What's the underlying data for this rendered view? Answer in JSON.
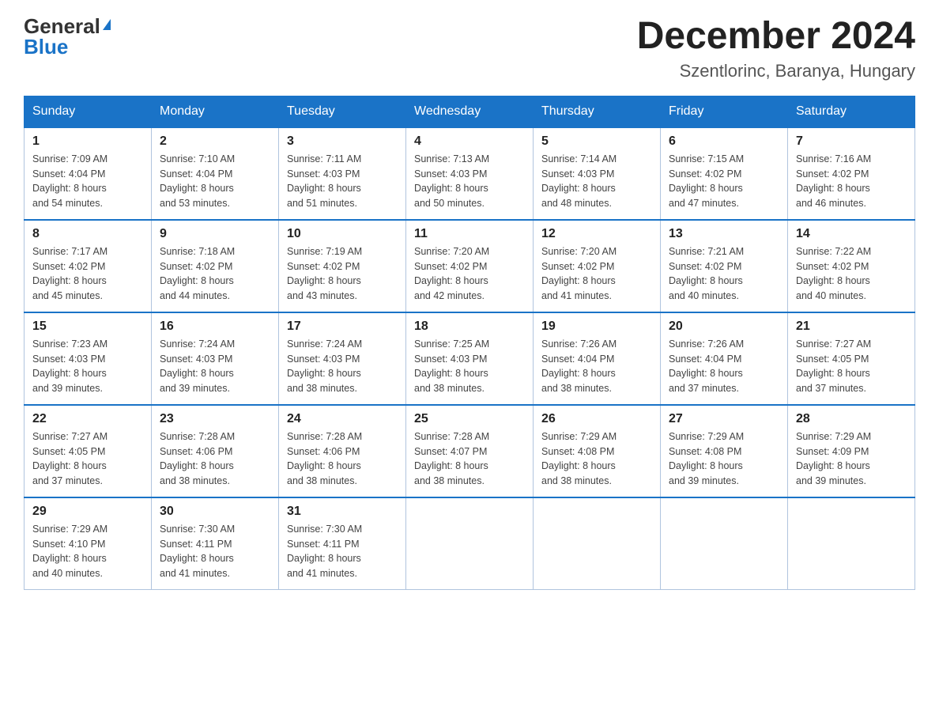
{
  "logo": {
    "general": "General",
    "blue": "Blue"
  },
  "title": "December 2024",
  "subtitle": "Szentlorinc, Baranya, Hungary",
  "days_of_week": [
    "Sunday",
    "Monday",
    "Tuesday",
    "Wednesday",
    "Thursday",
    "Friday",
    "Saturday"
  ],
  "weeks": [
    [
      {
        "day": "1",
        "sunrise": "7:09 AM",
        "sunset": "4:04 PM",
        "daylight": "8 hours and 54 minutes."
      },
      {
        "day": "2",
        "sunrise": "7:10 AM",
        "sunset": "4:04 PM",
        "daylight": "8 hours and 53 minutes."
      },
      {
        "day": "3",
        "sunrise": "7:11 AM",
        "sunset": "4:03 PM",
        "daylight": "8 hours and 51 minutes."
      },
      {
        "day": "4",
        "sunrise": "7:13 AM",
        "sunset": "4:03 PM",
        "daylight": "8 hours and 50 minutes."
      },
      {
        "day": "5",
        "sunrise": "7:14 AM",
        "sunset": "4:03 PM",
        "daylight": "8 hours and 48 minutes."
      },
      {
        "day": "6",
        "sunrise": "7:15 AM",
        "sunset": "4:02 PM",
        "daylight": "8 hours and 47 minutes."
      },
      {
        "day": "7",
        "sunrise": "7:16 AM",
        "sunset": "4:02 PM",
        "daylight": "8 hours and 46 minutes."
      }
    ],
    [
      {
        "day": "8",
        "sunrise": "7:17 AM",
        "sunset": "4:02 PM",
        "daylight": "8 hours and 45 minutes."
      },
      {
        "day": "9",
        "sunrise": "7:18 AM",
        "sunset": "4:02 PM",
        "daylight": "8 hours and 44 minutes."
      },
      {
        "day": "10",
        "sunrise": "7:19 AM",
        "sunset": "4:02 PM",
        "daylight": "8 hours and 43 minutes."
      },
      {
        "day": "11",
        "sunrise": "7:20 AM",
        "sunset": "4:02 PM",
        "daylight": "8 hours and 42 minutes."
      },
      {
        "day": "12",
        "sunrise": "7:20 AM",
        "sunset": "4:02 PM",
        "daylight": "8 hours and 41 minutes."
      },
      {
        "day": "13",
        "sunrise": "7:21 AM",
        "sunset": "4:02 PM",
        "daylight": "8 hours and 40 minutes."
      },
      {
        "day": "14",
        "sunrise": "7:22 AM",
        "sunset": "4:02 PM",
        "daylight": "8 hours and 40 minutes."
      }
    ],
    [
      {
        "day": "15",
        "sunrise": "7:23 AM",
        "sunset": "4:03 PM",
        "daylight": "8 hours and 39 minutes."
      },
      {
        "day": "16",
        "sunrise": "7:24 AM",
        "sunset": "4:03 PM",
        "daylight": "8 hours and 39 minutes."
      },
      {
        "day": "17",
        "sunrise": "7:24 AM",
        "sunset": "4:03 PM",
        "daylight": "8 hours and 38 minutes."
      },
      {
        "day": "18",
        "sunrise": "7:25 AM",
        "sunset": "4:03 PM",
        "daylight": "8 hours and 38 minutes."
      },
      {
        "day": "19",
        "sunrise": "7:26 AM",
        "sunset": "4:04 PM",
        "daylight": "8 hours and 38 minutes."
      },
      {
        "day": "20",
        "sunrise": "7:26 AM",
        "sunset": "4:04 PM",
        "daylight": "8 hours and 37 minutes."
      },
      {
        "day": "21",
        "sunrise": "7:27 AM",
        "sunset": "4:05 PM",
        "daylight": "8 hours and 37 minutes."
      }
    ],
    [
      {
        "day": "22",
        "sunrise": "7:27 AM",
        "sunset": "4:05 PM",
        "daylight": "8 hours and 37 minutes."
      },
      {
        "day": "23",
        "sunrise": "7:28 AM",
        "sunset": "4:06 PM",
        "daylight": "8 hours and 38 minutes."
      },
      {
        "day": "24",
        "sunrise": "7:28 AM",
        "sunset": "4:06 PM",
        "daylight": "8 hours and 38 minutes."
      },
      {
        "day": "25",
        "sunrise": "7:28 AM",
        "sunset": "4:07 PM",
        "daylight": "8 hours and 38 minutes."
      },
      {
        "day": "26",
        "sunrise": "7:29 AM",
        "sunset": "4:08 PM",
        "daylight": "8 hours and 38 minutes."
      },
      {
        "day": "27",
        "sunrise": "7:29 AM",
        "sunset": "4:08 PM",
        "daylight": "8 hours and 39 minutes."
      },
      {
        "day": "28",
        "sunrise": "7:29 AM",
        "sunset": "4:09 PM",
        "daylight": "8 hours and 39 minutes."
      }
    ],
    [
      {
        "day": "29",
        "sunrise": "7:29 AM",
        "sunset": "4:10 PM",
        "daylight": "8 hours and 40 minutes."
      },
      {
        "day": "30",
        "sunrise": "7:30 AM",
        "sunset": "4:11 PM",
        "daylight": "8 hours and 41 minutes."
      },
      {
        "day": "31",
        "sunrise": "7:30 AM",
        "sunset": "4:11 PM",
        "daylight": "8 hours and 41 minutes."
      },
      null,
      null,
      null,
      null
    ]
  ],
  "labels": {
    "sunrise": "Sunrise:",
    "sunset": "Sunset:",
    "daylight": "Daylight:"
  }
}
